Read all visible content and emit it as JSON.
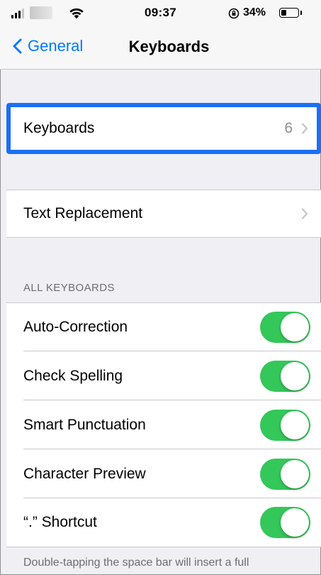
{
  "status_bar": {
    "time": "09:37",
    "battery_percent": "34%",
    "battery_level": 0.34
  },
  "nav": {
    "back_label": "General",
    "title": "Keyboards"
  },
  "groups": {
    "keyboards_row": {
      "label": "Keyboards",
      "value": "6"
    },
    "text_replacement": {
      "label": "Text Replacement"
    }
  },
  "all_keyboards": {
    "header": "ALL KEYBOARDS",
    "items": [
      {
        "label": "Auto-Correction",
        "on": true
      },
      {
        "label": "Check Spelling",
        "on": true
      },
      {
        "label": "Smart Punctuation",
        "on": true
      },
      {
        "label": "Character Preview",
        "on": true
      },
      {
        "label": "“.” Shortcut",
        "on": true
      }
    ],
    "footer": "Double-tapping the space bar will insert a full"
  },
  "colors": {
    "accent": "#007aff",
    "toggle_on": "#34c759",
    "selection_highlight": "#1b6ff5",
    "grouped_background": "#efeff4"
  },
  "icons": {
    "back": "chevron-left-icon",
    "disclosure": "chevron-right-icon",
    "wifi": "wifi-icon",
    "signal": "cellular-signal-icon",
    "orientation_lock": "orientation-lock-icon",
    "battery": "battery-icon"
  }
}
